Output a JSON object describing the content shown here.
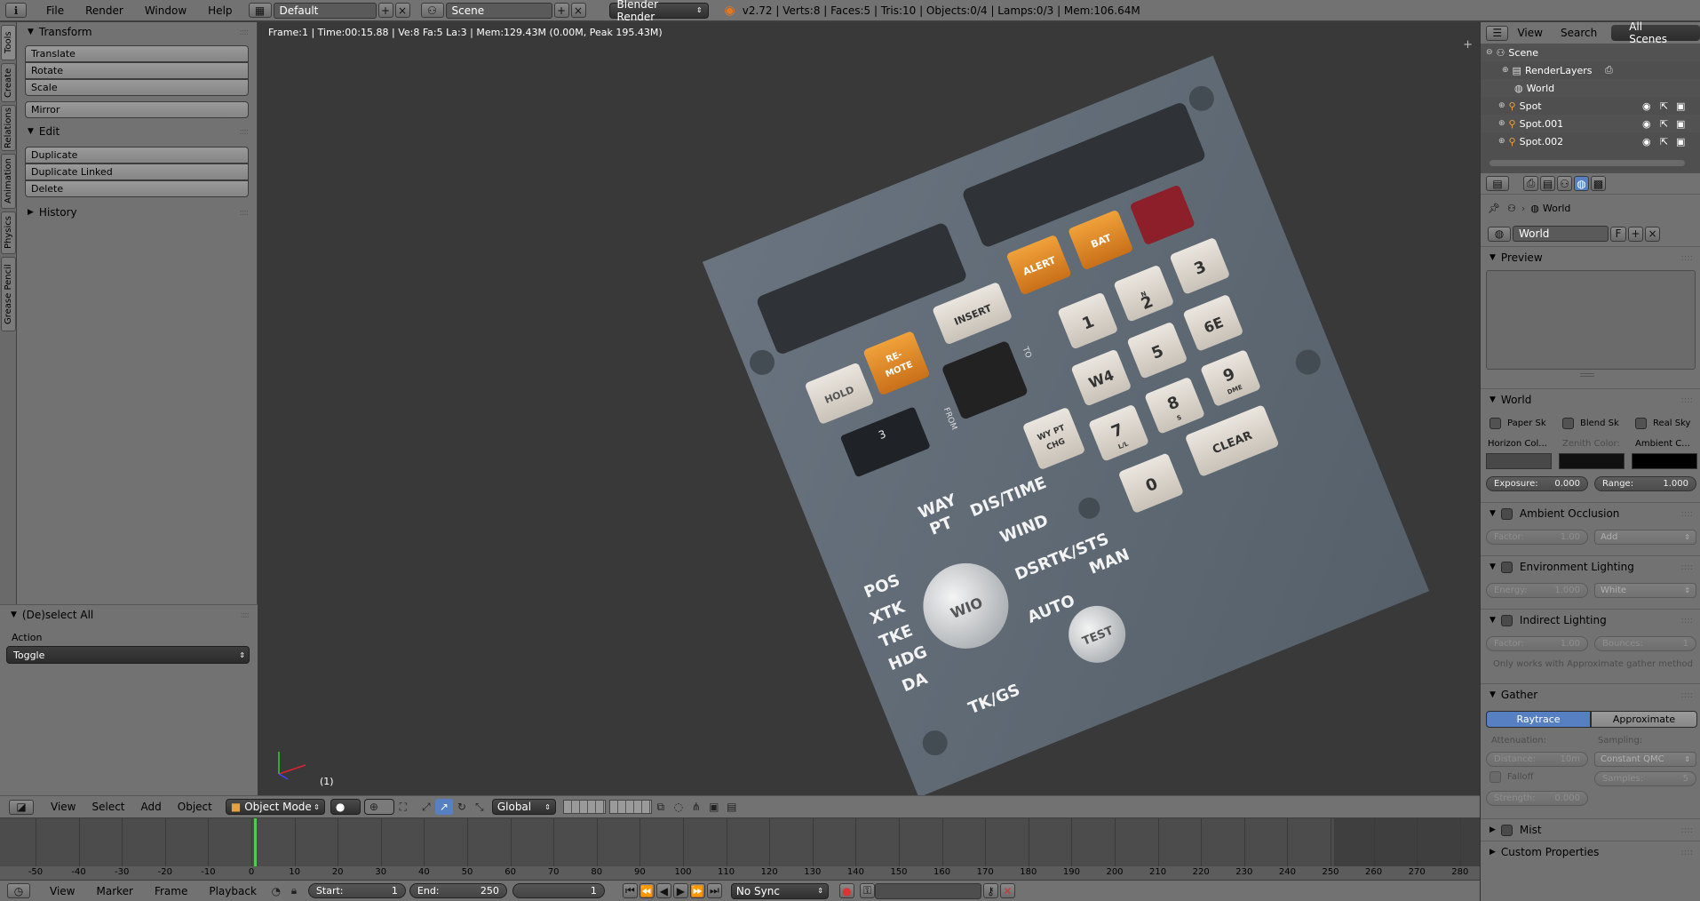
{
  "topbar": {
    "menus": [
      "File",
      "Render",
      "Window",
      "Help"
    ],
    "screen_layout": "Default",
    "scene": "Scene",
    "render_engine": "Blender Render",
    "stats": "v2.72 | Verts:8 | Faces:5 | Tris:10 | Objects:0/4 | Lamps:0/3 | Mem:106.64M"
  },
  "tabs": [
    "Tools",
    "Create",
    "Relations",
    "Animation",
    "Physics",
    "Grease Pencil"
  ],
  "toolshelf": {
    "transform_title": "Transform",
    "transform_buttons": [
      "Translate",
      "Rotate",
      "Scale"
    ],
    "mirror": "Mirror",
    "edit_title": "Edit",
    "edit_buttons": [
      "Duplicate",
      "Duplicate Linked",
      "Delete"
    ],
    "history_title": "History"
  },
  "operator": {
    "title": "(De)select All",
    "action_label": "Action",
    "action_value": "Toggle"
  },
  "viewport": {
    "info": "Frame:1 | Time:00:15.88 | Ve:8 Fa:5 La:3 | Mem:129.43M (0.00M, Peak 195.43M)",
    "frame_label": "(1)"
  },
  "panel_image": {
    "keys": [
      "ALERT",
      "BAT",
      "INSERT",
      "HOLD",
      "RE-",
      "MOTE",
      "1",
      "2",
      "3",
      "W4",
      "5",
      "6E",
      "7",
      "8",
      "9",
      "0",
      "CLEAR",
      "WY PT",
      "CHG"
    ],
    "dial_labels": [
      "WAY",
      "PT",
      "DIS/TIME",
      "WIND",
      "DSRTK/STS",
      "POS",
      "XTK",
      "TKE",
      "HDG",
      "DA",
      "TK/GS",
      "AUTO",
      "MAN",
      "TEST"
    ],
    "small_labels": [
      "N",
      "S",
      "L/L",
      "DME",
      "FROM",
      "TO",
      "WIO"
    ]
  },
  "view_header": {
    "menus": [
      "View",
      "Select",
      "Add",
      "Object"
    ],
    "mode": "Object Mode",
    "orientation": "Global"
  },
  "timeline": {
    "ticks": [
      "-50",
      "-40",
      "-30",
      "-20",
      "-10",
      "0",
      "10",
      "20",
      "30",
      "40",
      "50",
      "60",
      "70",
      "80",
      "90",
      "100",
      "110",
      "120",
      "130",
      "140",
      "150",
      "160",
      "170",
      "180",
      "190",
      "200",
      "210",
      "220",
      "230",
      "240",
      "250",
      "260",
      "270",
      "280"
    ],
    "menus": [
      "View",
      "Marker",
      "Frame",
      "Playback"
    ],
    "start_label": "Start:",
    "start_value": "1",
    "end_label": "End:",
    "end_value": "250",
    "current": "1",
    "sync": "No Sync"
  },
  "outliner": {
    "menus": [
      "View",
      "Search"
    ],
    "filter": "All Scenes",
    "items": [
      "Scene",
      "RenderLayers",
      "World",
      "Spot",
      "Spot.001",
      "Spot.002"
    ]
  },
  "properties": {
    "context": "World",
    "world_name": "World",
    "fake_user": "F",
    "preview_title": "Preview",
    "world_title": "World",
    "paper_sky": "Paper Sk",
    "blend_sky": "Blend Sk",
    "real_sky": "Real Sky",
    "horizon": "Horizon Col...",
    "zenith": "Zenith Color:",
    "ambient": "Ambient C...",
    "exposure_label": "Exposure:",
    "exposure_value": "0.000",
    "range_label": "Range:",
    "range_value": "1.000",
    "ao_title": "Ambient Occlusion",
    "ao_factor_label": "Factor:",
    "ao_factor_value": "1.00",
    "ao_blend": "Add",
    "env_title": "Environment Lighting",
    "env_energy_label": "Energy:",
    "env_energy_value": "1.000",
    "env_color": "White",
    "ind_title": "Indirect Lighting",
    "ind_factor_label": "Factor:",
    "ind_factor_value": "1.00",
    "ind_bounces_label": "Bounces:",
    "ind_bounces_value": "1",
    "ind_note": "Only works with Approximate gather method",
    "gather_title": "Gather",
    "gather_raytrace": "Raytrace",
    "gather_approx": "Approximate",
    "attenuation": "Attenuation:",
    "sampling": "Sampling:",
    "distance_label": "Distance:",
    "distance_value": "10m",
    "sampling_value": "Constant QMC",
    "falloff": "Falloff",
    "samples_label": "Samples:",
    "samples_value": "5",
    "strength_label": "Strength:",
    "strength_value": "0.000",
    "mist_title": "Mist",
    "custom_title": "Custom Properties"
  },
  "colors": {
    "accent_blue": "#5680c2",
    "alert_orange": "#e08a1e",
    "emer_red": "#8c1f2a"
  }
}
